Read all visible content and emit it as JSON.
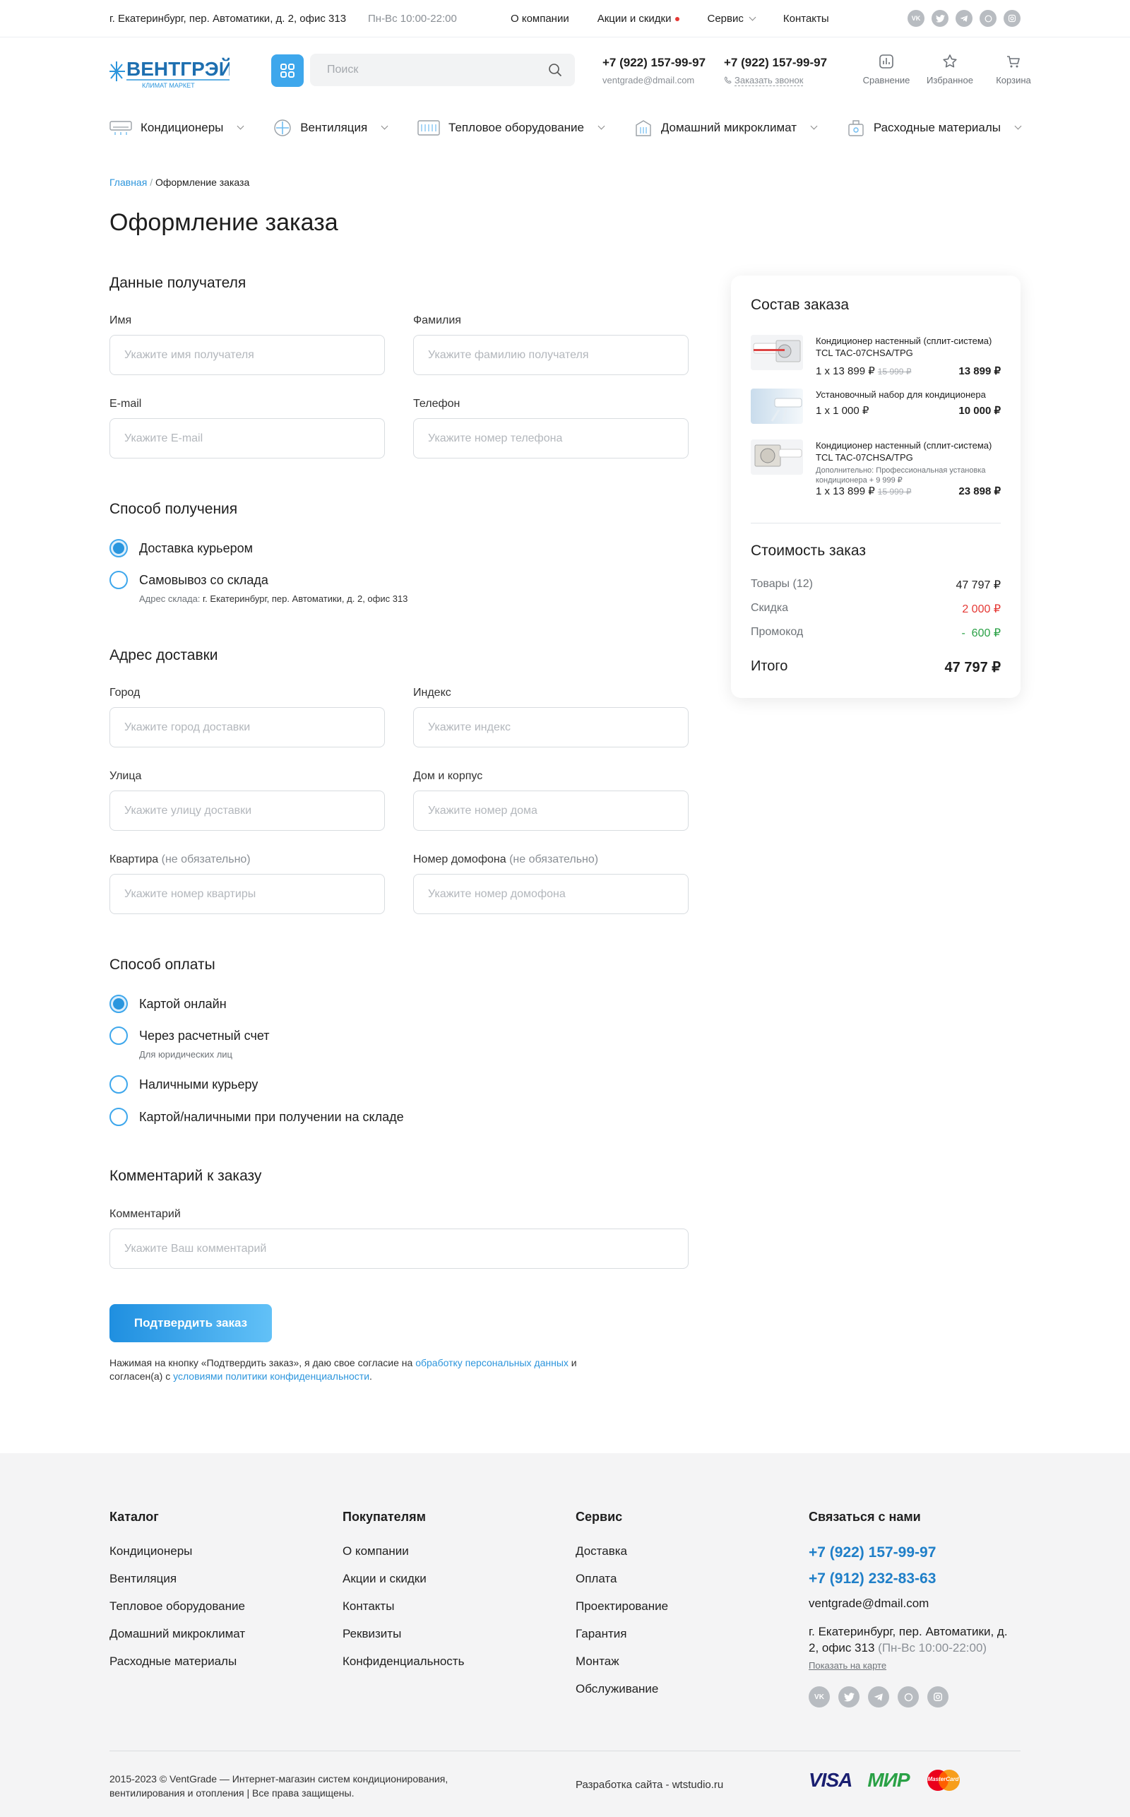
{
  "topbar": {
    "address": "г. Екатеринбург, пер. Автоматики, д. 2, офис 313",
    "hours": "Пн-Вс 10:00-22:00",
    "nav": [
      {
        "label": "О компании"
      },
      {
        "label": "Акции и скидки"
      },
      {
        "label": "Сервис"
      },
      {
        "label": "Контакты"
      }
    ],
    "socials": [
      "VK",
      "T",
      "TG",
      "WA",
      "IG"
    ]
  },
  "header": {
    "logo_main": "ВЕНТГРЭЙД",
    "logo_sub": "КЛИМАТ МАРКЕТ",
    "search_placeholder": "Поиск",
    "phone1": "+7 (922) 157-99-97",
    "email": "ventgrade@dmail.com",
    "phone2": "+7 (922) 157-99-97",
    "callback": "Заказать звонок",
    "icons": [
      {
        "label": "Сравнение",
        "icon": "compare-icon"
      },
      {
        "label": "Избранное",
        "icon": "star-icon"
      },
      {
        "label": "Корзина",
        "icon": "cart-icon"
      }
    ]
  },
  "catnav": [
    {
      "label": "Кондиционеры",
      "icon": "air-conditioner-icon"
    },
    {
      "label": "Вентиляция",
      "icon": "ventilation-icon"
    },
    {
      "label": "Тепловое оборудование",
      "icon": "heater-icon"
    },
    {
      "label": "Домашний микроклимат",
      "icon": "humidifier-icon"
    },
    {
      "label": "Расходные материалы",
      "icon": "supplies-icon"
    }
  ],
  "breadcrumbs": {
    "home": "Главная",
    "sep": "/",
    "current": "Оформление заказа"
  },
  "page_title": "Оформление заказа",
  "recipient": {
    "title": "Данные получателя",
    "name_label": "Имя",
    "name_placeholder": "Укажите имя получателя",
    "surname_label": "Фамилия",
    "surname_placeholder": "Укажите фамилию получателя",
    "email_label": "E-mail",
    "email_placeholder": "Укажите E-mail",
    "phone_label": "Телефон",
    "phone_placeholder": "Укажите номер телефона"
  },
  "delivery_method": {
    "title": "Способ получения",
    "courier": "Доставка курьером",
    "pickup": "Самовывоз со склада",
    "pickup_hint_label": "Адрес склада:",
    "pickup_hint_value": "г. Екатеринбург, пер. Автоматики, д. 2, офис 313"
  },
  "address": {
    "title": "Адрес доставки",
    "city_label": "Город",
    "city_placeholder": "Укажите город доставки",
    "index_label": "Индекс",
    "index_placeholder": "Укажите индекс",
    "street_label": "Улица",
    "street_placeholder": "Укажите улицу доставки",
    "house_label": "Дом и корпус",
    "house_placeholder": "Укажите номер дома",
    "flat_label": "Квартира",
    "flat_placeholder": "Укажите номер квартиры",
    "intercom_label": "Номер домофона",
    "intercom_placeholder": "Укажите номер домофона",
    "optional": "(не обязательно)"
  },
  "payment": {
    "title": "Способ оплаты",
    "card_online": "Картой онлайн",
    "invoice": "Через расчетный счет",
    "invoice_hint": "Для юридических лиц",
    "cash_courier": "Наличными курьеру",
    "on_pickup": "Картой/наличными при получении на складе"
  },
  "comment": {
    "title": "Комментарий к заказу",
    "label": "Комментарий",
    "placeholder": "Укажите Ваш комментарий"
  },
  "submit_label": "Подтвердить заказ",
  "consent": {
    "text1": "Нажимая на кнопку «Подтвердить заказ», я даю свое согласие на ",
    "link1": "обработку персональных данных",
    "text2": " и согласен(а) с ",
    "link2": "условиями политики конфиденциальности",
    "text3": "."
  },
  "summary": {
    "title": "Состав заказа",
    "items": [
      {
        "name": "Кондиционер настенный (сплит-система) TCL TAC-07CHSA/TPG",
        "qty": "1 x 13 899 ₽",
        "old": "15 999 ₽",
        "total": "13 899 ₽",
        "addon": ""
      },
      {
        "name": "Установочный набор для кондиционера",
        "qty": "1 x 1 000 ₽",
        "old": "",
        "total": "10 000 ₽",
        "addon": ""
      },
      {
        "name": "Кондиционер настенный (сплит-система) TCL TAC-07CHSA/TPG",
        "qty": "1 x 13 899 ₽",
        "old": "15 999 ₽",
        "total": "23 898 ₽",
        "addon": "Дополнительно: Профессиональная установка кондиционера + 9 999 ₽"
      }
    ],
    "cost_title": "Стоимость заказ",
    "goods_label": "Товары (12)",
    "goods_value": "47 797 ₽",
    "discount_label": "Скидка",
    "discount_value": "2 000 ₽",
    "promo_label": "Промокод",
    "promo_value": "-  600 ₽",
    "total_label": "Итого",
    "total_value": "47 797 ₽"
  },
  "footer": {
    "catalog": {
      "title": "Каталог",
      "links": [
        "Кондиционеры",
        "Вентиляция",
        "Тепловое оборудование",
        "Домашний микроклимат",
        "Расходные материалы"
      ]
    },
    "buyers": {
      "title": "Покупателям",
      "links": [
        "О компании",
        "Акции и скидки",
        "Контакты",
        "Реквизиты",
        "Конфиденциальность"
      ]
    },
    "service": {
      "title": "Сервис",
      "links": [
        "Доставка",
        "Оплата",
        "Проектирование",
        "Гарантия",
        "Монтаж",
        "Обслуживание"
      ]
    },
    "contacts": {
      "title": "Связаться с нами",
      "phone1": "+7 (922) 157-99-97",
      "phone2": "+7 (912) 232-83-63",
      "email": "ventgrade@dmail.com",
      "address": "г. Екатеринбург, пер. Автоматики, д. 2, офис 313",
      "hours": "(Пн-Вс 10:00-22:00)",
      "map_link": "Показать на карте"
    },
    "copyright_line1": "2015-2023 © VentGrade — Интернет-магазин систем кондиционирования,",
    "copyright_line2": "вентилирования и отопления | Все права защищены.",
    "developer": "Разработка сайта - wtstudio.ru",
    "payments": [
      "VISA",
      "МИР",
      "MasterCard"
    ]
  },
  "colors": {
    "accent": "#2c95dc",
    "discount": "#e53935",
    "promo": "#2aa146"
  }
}
